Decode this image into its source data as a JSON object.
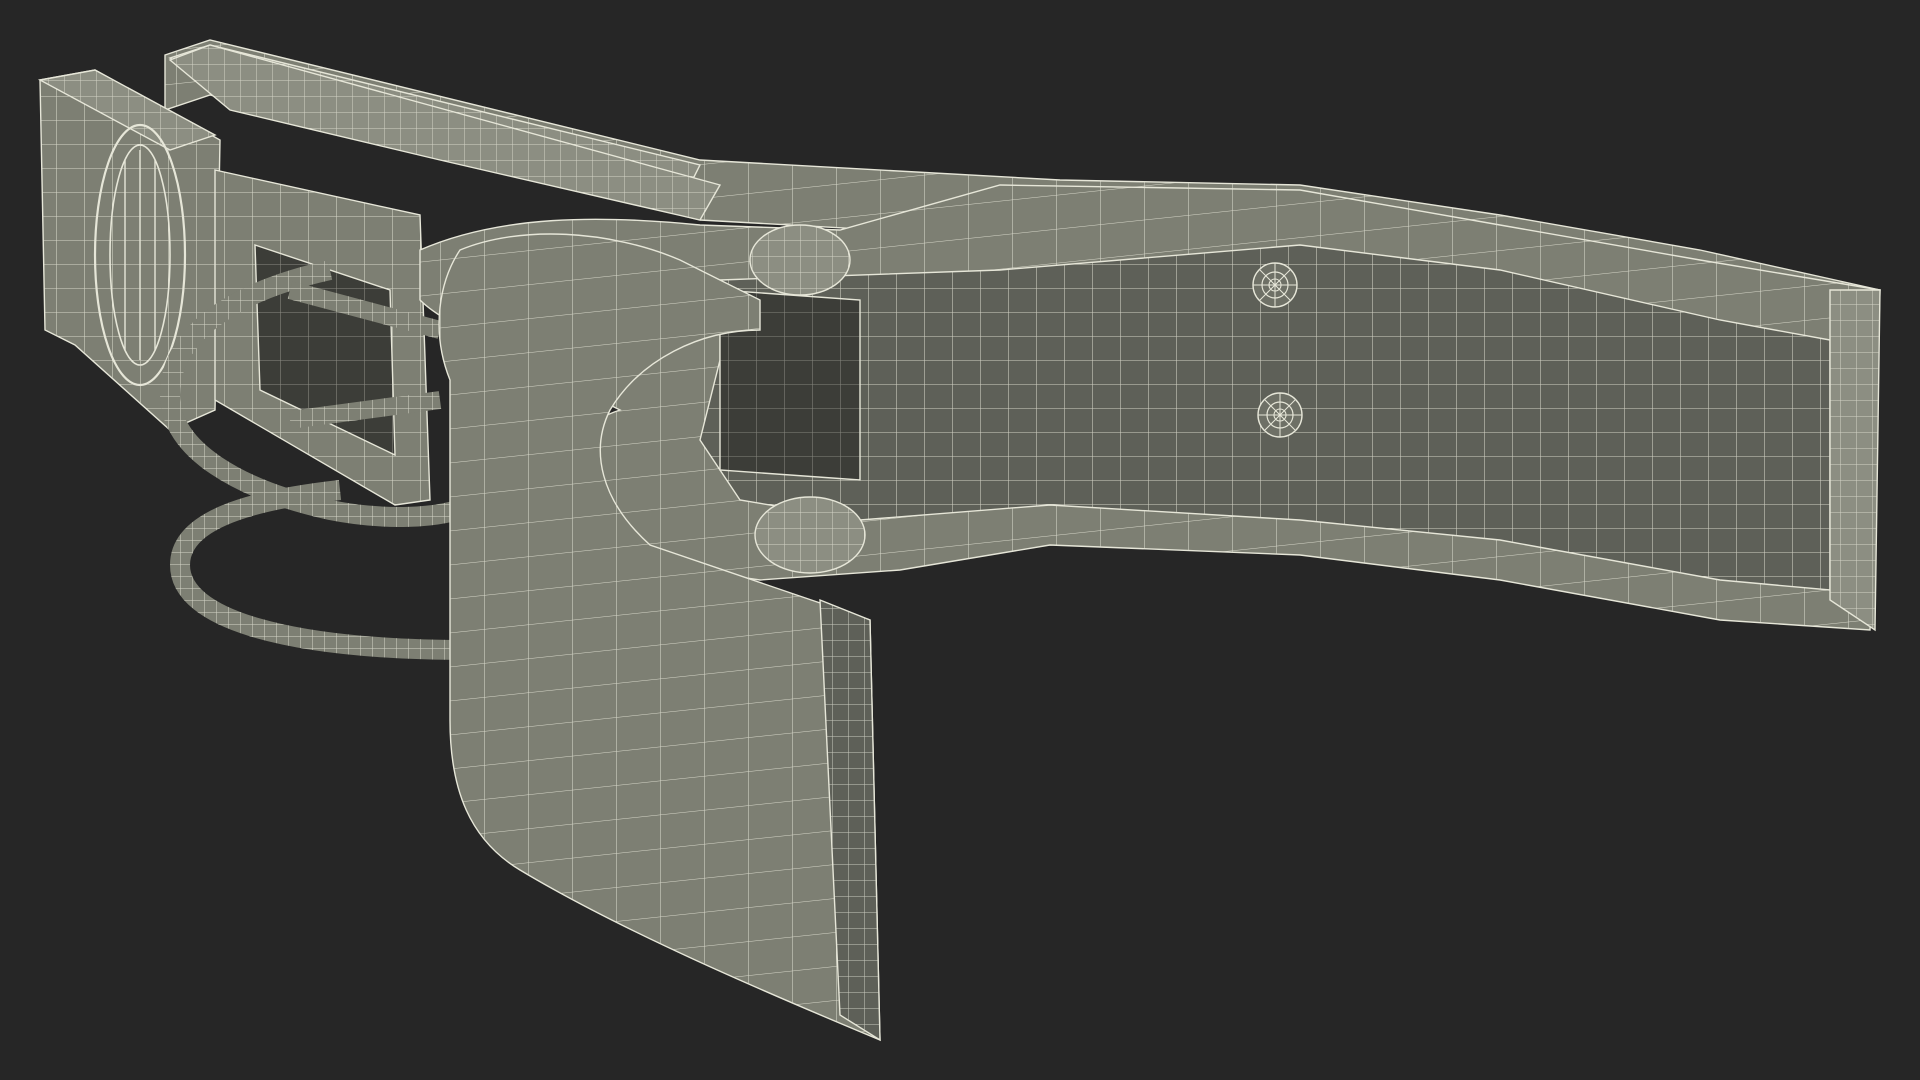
{
  "scene": {
    "background_color": "#262626",
    "surface_color": "#7d7f73",
    "surface_light_color": "#8c8e82",
    "surface_dark_color": "#5e6058",
    "inner_shadow_color": "#3c3d38",
    "wire_color": "#e6e6d8",
    "subject": "wireframe-clamp-model"
  }
}
